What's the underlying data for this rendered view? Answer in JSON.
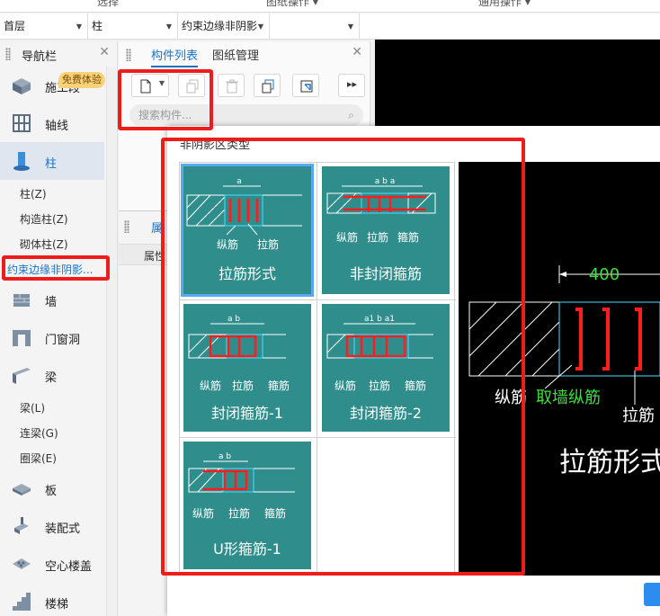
{
  "ribbon": {
    "labels": [
      "选择",
      "图纸操作 ▾",
      "通用操作 ▾"
    ]
  },
  "combos": {
    "floor": "首层",
    "category": "柱",
    "type": "约束边缘非阴影"
  },
  "nav": {
    "title": "导航栏",
    "badge": "免费体验",
    "items": [
      {
        "label": "施工段",
        "icon": "construction-section-icon"
      },
      {
        "label": "轴线",
        "icon": "axis-icon"
      },
      {
        "label": "柱",
        "icon": "column-icon"
      },
      {
        "label": "墙",
        "icon": "wall-icon"
      },
      {
        "label": "门窗洞",
        "icon": "door-window-icon"
      },
      {
        "label": "梁",
        "icon": "beam-icon"
      },
      {
        "label": "板",
        "icon": "slab-icon"
      },
      {
        "label": "装配式",
        "icon": "prefab-icon"
      },
      {
        "label": "空心楼盖",
        "icon": "hollow-floor-icon"
      },
      {
        "label": "楼梯",
        "icon": "stairs-icon"
      }
    ],
    "column_sub": [
      "柱(Z)",
      "构造柱(Z)",
      "砌体柱(Z)",
      "约束边缘非阴影..."
    ],
    "beam_sub": [
      "梁(L)",
      "连梁(G)",
      "圈梁(E)"
    ]
  },
  "complist": {
    "tabs": [
      "构件列表",
      "图纸管理"
    ],
    "search_placeholder": "搜索构件..."
  },
  "attr": {
    "tab": "属",
    "header": "属性"
  },
  "dialog": {
    "title": "非阴影区类型",
    "options": [
      {
        "caption": "拉筋形式",
        "labels": [
          "纵筋",
          "拉筋"
        ],
        "dim": "a"
      },
      {
        "caption": "非封闭箍筋",
        "labels": [
          "纵筋",
          "拉筋",
          "箍筋"
        ],
        "dim": "a b a"
      },
      {
        "caption": "封闭箍筋-1",
        "labels": [
          "纵筋",
          "拉筋",
          "箍筋"
        ],
        "dim": "a b"
      },
      {
        "caption": "封闭箍筋-2",
        "labels": [
          "纵筋",
          "拉筋",
          "箍筋"
        ],
        "dim": "a1 b a1"
      },
      {
        "caption": "U形箍筋-1",
        "labels": [
          "纵筋",
          "拉筋",
          "箍筋"
        ],
        "dim": "a b"
      }
    ],
    "selected_index": 0,
    "preview": {
      "dimension": "400",
      "label_long": "纵筋",
      "label_long_note": "取墙纵筋",
      "label_tie": "拉筋",
      "caption": "拉筋形式"
    }
  },
  "colors": {
    "accent": "#1a73c8",
    "tile": "#2f8e8c",
    "highlight": "#ef1c1c",
    "rebar": "#ff1e1e"
  }
}
